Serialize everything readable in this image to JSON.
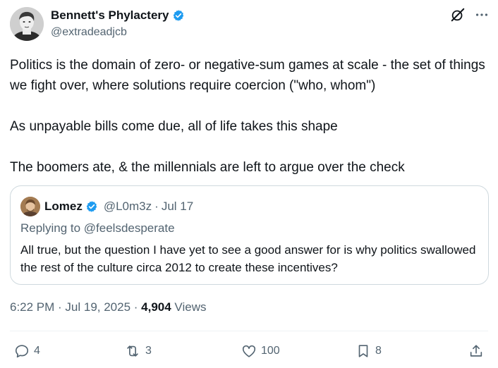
{
  "author": {
    "display_name": "Bennett's Phylactery",
    "handle": "@extradeadjcb",
    "verified": true
  },
  "icons": {
    "verified": "verified-badge-icon",
    "grok": "grok-icon",
    "more": "more-icon",
    "reply": "reply-icon",
    "retweet": "retweet-icon",
    "like": "like-icon",
    "bookmark": "bookmark-icon",
    "share": "share-icon"
  },
  "tweet": {
    "paragraphs": [
      "Politics is the domain of zero- or negative-sum games at scale - the set of things we fight over, where solutions require coercion (\"who, whom\")",
      "As unpayable bills come due, all of life takes this shape",
      "The boomers ate, & the millennials are left to argue over the check"
    ]
  },
  "quote": {
    "display_name": "Lomez",
    "handle": "@L0m3z",
    "separator": "·",
    "date": "Jul 17",
    "replying_to": "Replying to @feelsdesperate",
    "text": "All true, but the question I have yet to see a good answer for is why politics swallowed the rest of the culture circa 2012 to create these incentives?"
  },
  "meta": {
    "timestamp": "6:22 PM · Jul 19, 2025 · ",
    "views_count": "4,904",
    "views_label": " Views"
  },
  "actions": {
    "reply_count": "4",
    "retweet_count": "3",
    "like_count": "100",
    "bookmark_count": "8"
  },
  "colors": {
    "text": "#0f1419",
    "secondary": "#536471",
    "verified_blue": "#1d9bf0",
    "border": "#cfd9de"
  }
}
